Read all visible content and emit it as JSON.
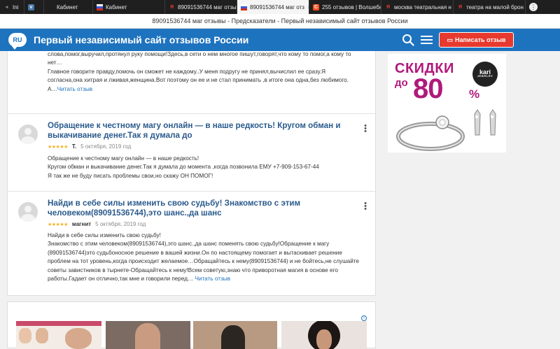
{
  "browser": {
    "tabs": [
      {
        "label": "Ini",
        "icon": "pause-icon",
        "color": "#888888"
      },
      {
        "label": "",
        "icon": "vk-icon",
        "color": "#4a76a8"
      },
      {
        "label": "Кабинет",
        "icon": "tab-page-icon",
        "color": "#ffffff"
      },
      {
        "label": "Кабинет",
        "icon": "flag-icon",
        "color": "#cccccc"
      },
      {
        "label": "89091536744 маг отзы",
        "icon": "yandex-icon",
        "color": "#e53935"
      },
      {
        "label": "89091536744 маг отз",
        "icon": "flag-icon",
        "color": "#cccccc",
        "active": true
      },
      {
        "label": "255 отзывов | Волшебн",
        "icon": "site-c-icon",
        "color": "#f4511e"
      },
      {
        "label": "москва театральная н",
        "icon": "yandex-icon",
        "color": "#e53935"
      },
      {
        "label": "театра на малой брон",
        "icon": "yandex-icon",
        "color": "#e53935"
      }
    ],
    "window_title": "89091536744 маг отзывы - Предсказатели - Первый независимый сайт отзывов России"
  },
  "header": {
    "logo_text": "RU",
    "site_title": "Первый независимый сайт отзывов России",
    "write_button": "Написать отзыв",
    "accent": "#1e73be",
    "button_color": "#e8392e"
  },
  "reviews": [
    {
      "text": "слова,помог,выручил,протянул руку помощи!Здесь,в сети о нем многое пишут,говорят,что кому то помог,а кому то нет…\nГлавное говорите правду,помочь он сможет не каждому..У меня подругу не принял,вычислил ее сразу.Я согласна,она хитрая и лживая,женщина.Вот поэтому он ее и не стал принимать ,в итоге она одна,без любимого.\nА…",
      "more": "Читать отзыв"
    },
    {
      "title": "Обращение к честному магу онлайн — в наше редкость! Кругом обман и выкачивание денег.Так я думала до",
      "stars": "★★★★★",
      "rating": 5,
      "author": "Т.",
      "date": "5 октября, 2019 год",
      "text": "Обращение к честному магу онлайн — в наше редкость!\nКругом обман и выкачивание денег.Так я думала до момента ,когда позвонила ЕМУ +7-909-153-67-44\nЯ так же не буду писать проблемы свои,но скажу ОН ПОМОГ!"
    },
    {
      "title": "Найди в себе силы изменить свою судьбу! Знакомство с этим человеком(89091536744),это шанс.,да шанс",
      "stars": "★★★★★",
      "rating": 5,
      "author": "магнит",
      "date": "5 октября, 2019 год",
      "text": "Найди в себе силы изменить свою судьбу!\nЗнакомство с этим человеком(89091536744),это шанс.,да шанс поменять свою судьбу!Обращение к магу (89091536744)это судьбоносное решение в вашей жизни.Он по настоящему помогает и вытаскивает решение проблем на тот уровень,когда происходит желаемое…Обращайтесь к нему(89091536744) и не бойтесь,не слушайте советы завистников в тырнете-Обращайтесь к нему!Всем советую,знаю что приворотная магия в основе его работы.Гадает он отлично,так мне и говорили перед…",
      "more": "Читать отзыв"
    }
  ],
  "banner": {
    "line1": "СКИДКИ",
    "line2": "до",
    "amount": "80",
    "percent": "%",
    "brand": "kari",
    "brand_sub": "JEWELRY",
    "color": "#b0197b"
  },
  "ad": {
    "info": "i"
  }
}
